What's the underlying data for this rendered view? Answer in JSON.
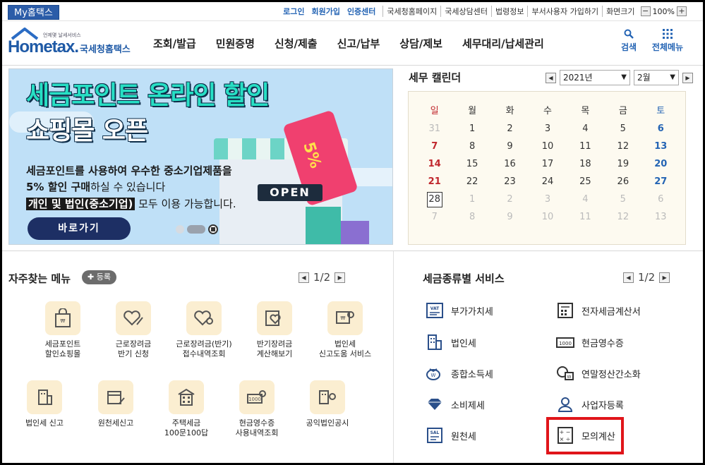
{
  "topbar": {
    "myhome": "My홈택스",
    "login": "로그인",
    "join": "회원가입",
    "cert": "인증센터",
    "links": [
      "국세청홈페이지",
      "국세상담센터",
      "법령정보",
      "부서사용자 가입하기",
      "화면크기"
    ],
    "zoom_minus": "−",
    "zoom": "100%",
    "zoom_plus": "+"
  },
  "header": {
    "logo_small": "언제몇 날세서비스",
    "logo_word": "Hometax.",
    "logo_kr": "국세청홈택스",
    "nav": [
      "조회/발급",
      "민원증명",
      "신청/제출",
      "신고/납부",
      "상담/제보",
      "세무대리/납세관리"
    ],
    "search_label": "검색",
    "allmenu_label": "전체메뉴"
  },
  "banner": {
    "title1": "세금포인트 온라인 할인",
    "title2": "쇼핑몰 오픈",
    "line1": "세금포인트를 사용하여 우수한 중소기업제품을",
    "line2_bold": "5% 할인 구매",
    "line2_rest": "하실 수 있습니다",
    "line3_hl": "개인 및 법인(중소기업)",
    "line3_rest": " 모두 이용 가능합니다.",
    "button": "바로가기",
    "open_sign": "OPEN",
    "tag_text": "5%"
  },
  "calendar": {
    "title": "세무 캘린더",
    "year": "2021년",
    "month": "2월",
    "weekdays": [
      "일",
      "월",
      "화",
      "수",
      "목",
      "금",
      "토"
    ],
    "weeks": [
      [
        "31",
        "1",
        "2",
        "3",
        "4",
        "5",
        "6"
      ],
      [
        "7",
        "8",
        "9",
        "10",
        "11",
        "12",
        "13"
      ],
      [
        "14",
        "15",
        "16",
        "17",
        "18",
        "19",
        "20"
      ],
      [
        "21",
        "22",
        "23",
        "24",
        "25",
        "26",
        "27"
      ],
      [
        "28",
        "1",
        "2",
        "3",
        "4",
        "5",
        "6"
      ],
      [
        "7",
        "8",
        "9",
        "10",
        "11",
        "12",
        "13"
      ]
    ]
  },
  "frequent": {
    "title": "자주찾는 메뉴",
    "add": "등록",
    "page": "1/2",
    "items": [
      {
        "label": "세금포인트\n할인쇼핑몰"
      },
      {
        "label": "근로장려금\n반기 신청"
      },
      {
        "label": "근로장려금(반기)\n접수내역조회"
      },
      {
        "label": "반기장려금\n계산해보기"
      },
      {
        "label": "법인세\n신고도움 서비스"
      },
      {
        "label": "법인세 신고"
      },
      {
        "label": "원천세신고"
      },
      {
        "label": "주택세금\n100문100답"
      },
      {
        "label": "현금영수증\n사용내역조회"
      },
      {
        "label": "공익법인공시"
      }
    ]
  },
  "taxservice": {
    "title": "세금종류별 서비스",
    "page": "1/2",
    "items": [
      {
        "label": "부가가치세"
      },
      {
        "label": "전자세금계산서"
      },
      {
        "label": "법인세"
      },
      {
        "label": "현금영수증"
      },
      {
        "label": "종합소득세"
      },
      {
        "label": "연말정산간소화"
      },
      {
        "label": "소비제세"
      },
      {
        "label": "사업자등록"
      },
      {
        "label": "원천세"
      },
      {
        "label": "모의계산"
      }
    ]
  },
  "colors": {
    "brand": "#1f5aa6",
    "highlight": "#e0151a",
    "icon_bg": "#fbeed1"
  }
}
